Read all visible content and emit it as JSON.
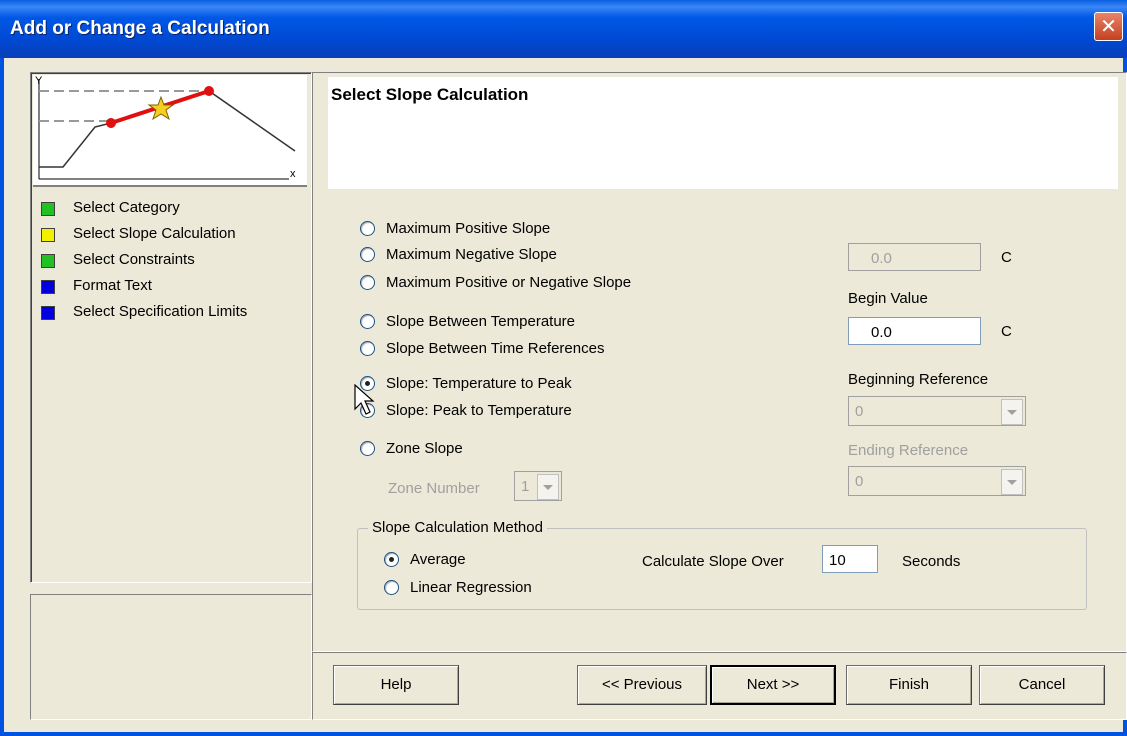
{
  "window": {
    "title": "Add or Change a Calculation",
    "close_glyph": "✕"
  },
  "steps": [
    {
      "label": "Select Category",
      "color": "#22c022"
    },
    {
      "label": "Select Slope Calculation",
      "color": "#f0f000"
    },
    {
      "label": "Select Constraints",
      "color": "#22c022"
    },
    {
      "label": "Format Text",
      "color": "#0000e0"
    },
    {
      "label": "Select Specification Limits",
      "color": "#0000e0"
    }
  ],
  "thumbnail": {
    "y_label": "Y",
    "x_label": "x"
  },
  "main": {
    "heading": "Select Slope Calculation",
    "options": [
      {
        "label": "Maximum Positive Slope",
        "checked": false
      },
      {
        "label": "Maximum Negative Slope",
        "checked": false
      },
      {
        "label": "Maximum Positive or Negative Slope",
        "checked": false
      },
      {
        "label": "Slope Between Temperature",
        "checked": false
      },
      {
        "label": "Slope Between Time References",
        "checked": false
      },
      {
        "label": "Slope: Temperature to Peak",
        "checked": true
      },
      {
        "label": "Slope: Peak to Temperature",
        "checked": false
      },
      {
        "label": "Zone Slope",
        "checked": false
      }
    ],
    "zone_number_label": "Zone Number",
    "zone_number_value": "1",
    "end_value": "0.0",
    "end_unit": "C",
    "begin_value_label": "Begin Value",
    "begin_value": "0.0",
    "begin_unit": "C",
    "beginning_reference_label": "Beginning Reference",
    "beginning_reference_value": "0",
    "ending_reference_label": "Ending Reference",
    "ending_reference_value": "0",
    "method": {
      "legend": "Slope Calculation Method",
      "average_label": "Average",
      "average_checked": true,
      "linear_label": "Linear Regression",
      "linear_checked": false,
      "calc_over_label": "Calculate Slope Over",
      "calc_over_value": "10",
      "seconds_label": "Seconds"
    }
  },
  "buttons": {
    "help": "Help",
    "previous": "<< Previous",
    "next": "Next >>",
    "finish": "Finish",
    "cancel": "Cancel"
  }
}
